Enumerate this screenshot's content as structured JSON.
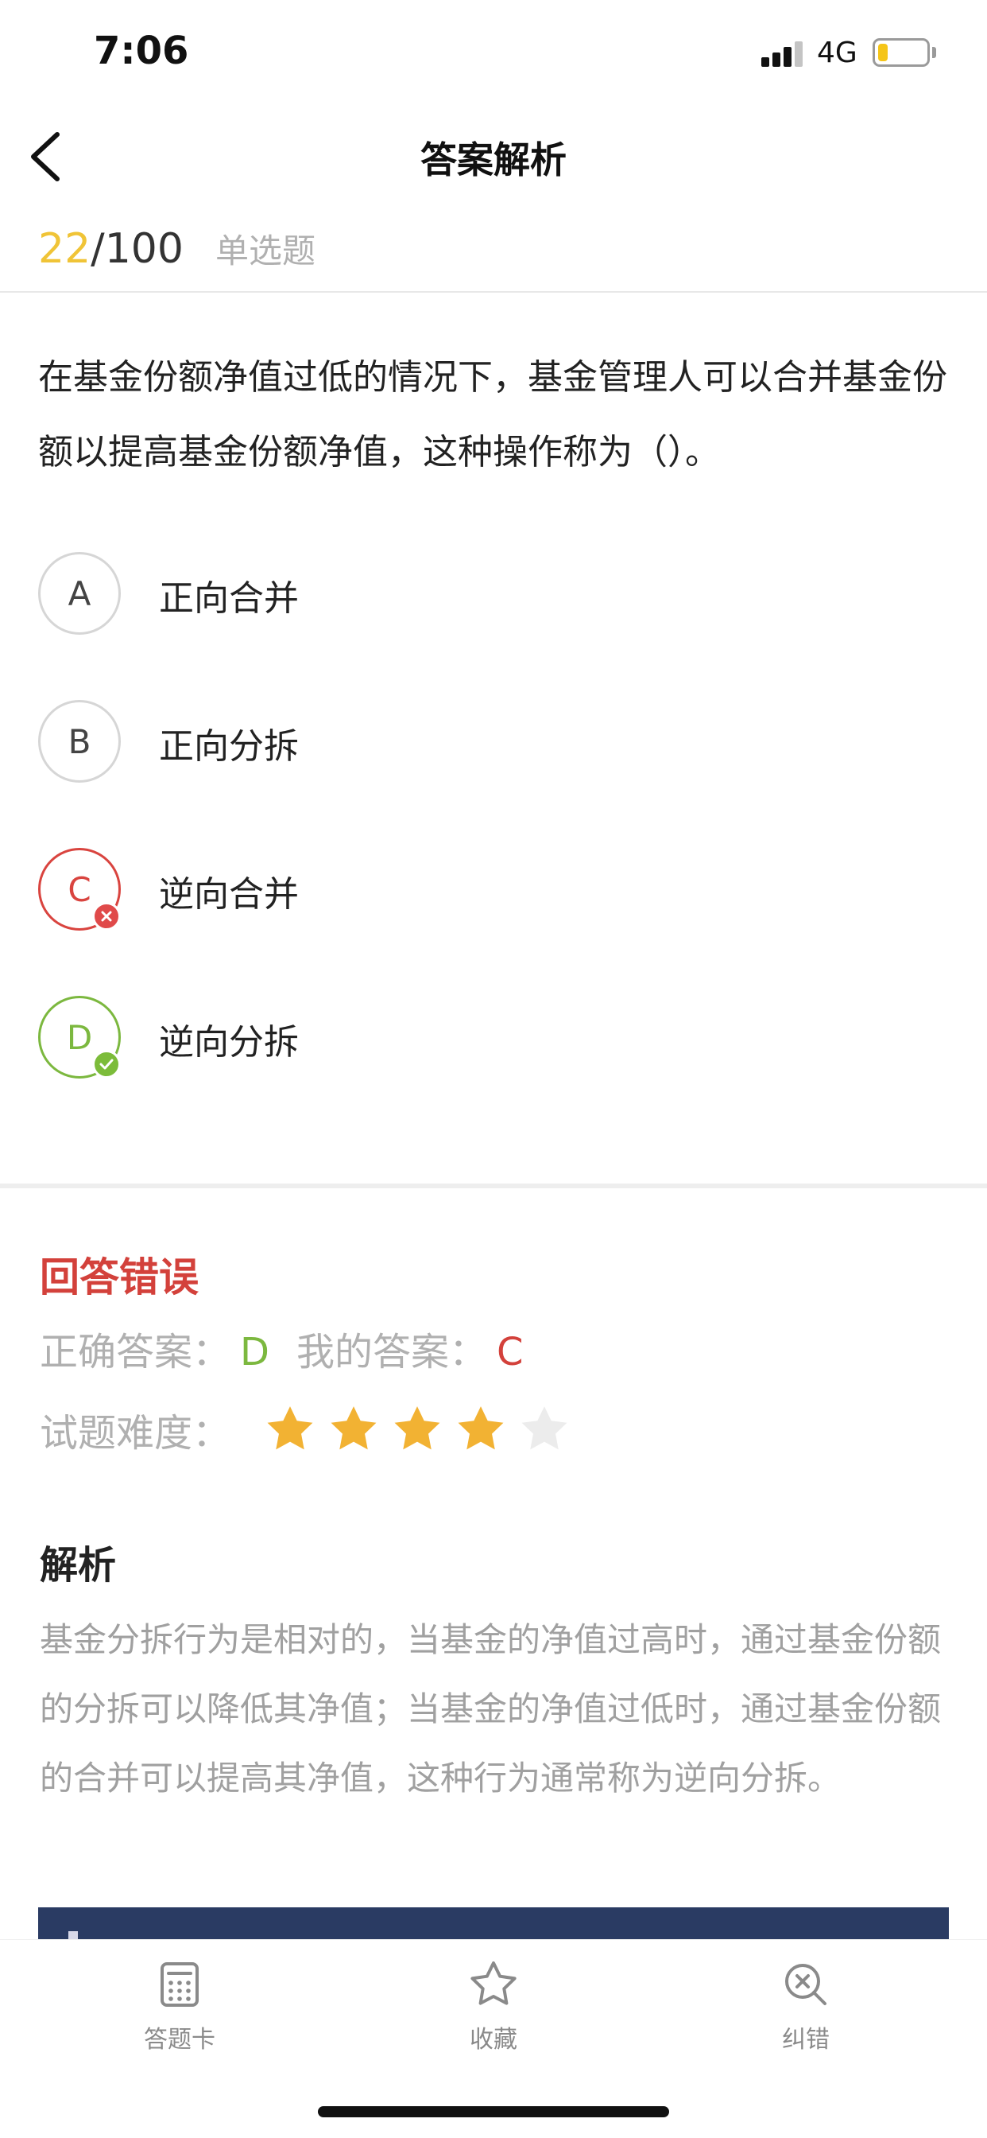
{
  "status_bar": {
    "time": "7:06",
    "network": "4G",
    "battery_level": 0.2
  },
  "nav": {
    "title": "答案解析"
  },
  "progress": {
    "current": "22",
    "total": "/100",
    "type": "单选题"
  },
  "question": {
    "text": "在基金份额净值过低的情况下，基金管理人可以合并基金份额以提高基金份额净值，这种操作称为（）。",
    "options": [
      {
        "letter": "A",
        "text": "正向合并",
        "state": "normal"
      },
      {
        "letter": "B",
        "text": "正向分拆",
        "state": "normal"
      },
      {
        "letter": "C",
        "text": "逆向合并",
        "state": "wrong"
      },
      {
        "letter": "D",
        "text": "逆向分拆",
        "state": "correct"
      }
    ]
  },
  "result": {
    "title": "回答错误",
    "correct_label": "正确答案：",
    "correct_value": "D",
    "mine_label": "我的答案：",
    "mine_value": "C",
    "difficulty_label": "试题难度：",
    "difficulty_stars": 4,
    "difficulty_max": 5
  },
  "analysis": {
    "title": "解析",
    "text": "基金分拆行为是相对的，当基金的净值过高时，通过基金份额的分拆可以降低其净值；当基金的净值过低时，通过基金份额的合并可以提高其净值，这种行为通常称为逆向分拆。"
  },
  "tabs": [
    {
      "label": "答题卡",
      "icon": "answer-card-icon"
    },
    {
      "label": "收藏",
      "icon": "star-icon"
    },
    {
      "label": "纠错",
      "icon": "report-error-icon"
    }
  ],
  "colors": {
    "accent_yellow": "#f0c437",
    "wrong_red": "#d3413b",
    "correct_green": "#7cb83f",
    "muted_gray": "#b0b0b0"
  }
}
